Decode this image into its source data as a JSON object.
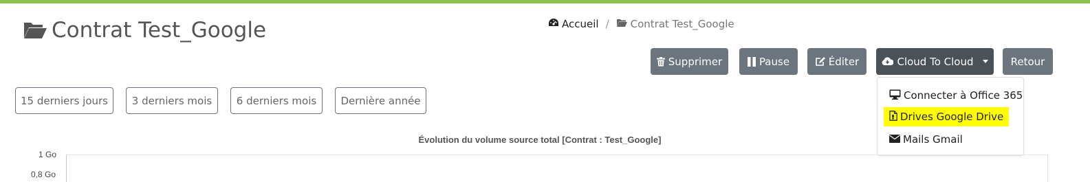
{
  "header": {
    "title": "Contrat Test_Google",
    "title_icon": "folder-open-icon"
  },
  "breadcrumb": {
    "home_label": "Accueil",
    "home_icon": "dashboard-icon",
    "separator": "/",
    "current_label": "Contrat Test_Google",
    "current_icon": "folder-open-icon"
  },
  "toolbar": {
    "delete_label": "Supprimer",
    "pause_label": "Pause",
    "edit_label": "Éditer",
    "cloud_label": "Cloud To Cloud",
    "back_label": "Retour"
  },
  "cloud_menu": {
    "items": [
      {
        "label": "Connecter à Office 365",
        "icon": "desktop-icon"
      },
      {
        "label": "Drives Google Drive",
        "icon": "file-icon"
      },
      {
        "label": "Mails Gmail",
        "icon": "envelope-icon"
      }
    ]
  },
  "ranges": [
    "15 derniers jours",
    "3 derniers mois",
    "6 derniers mois",
    "Dernière année"
  ],
  "chart": {
    "title": "Évolution du volume source total [Contrat : Test_Google]",
    "y_ticks": [
      "1 Go",
      "0,8 Go"
    ]
  },
  "colors": {
    "accent_bar": "#8bc34a",
    "button_gray": "#6c757d",
    "button_dark": "#4a5157",
    "highlight": "#ffff00"
  }
}
